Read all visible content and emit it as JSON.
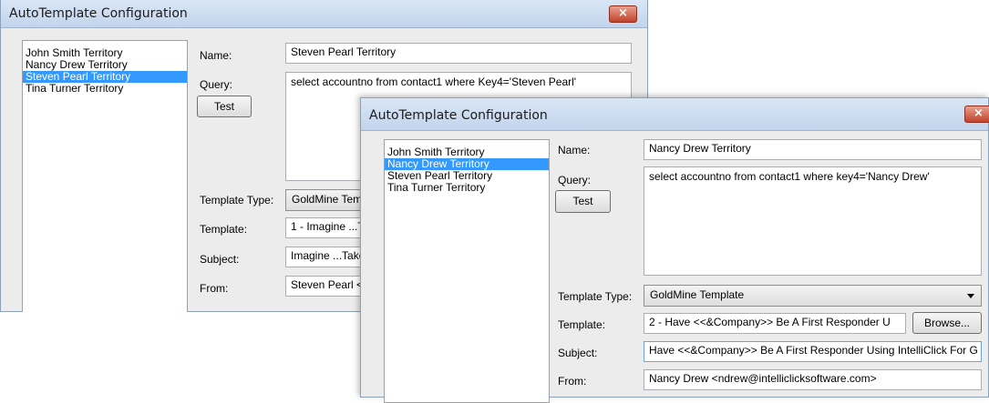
{
  "back_window": {
    "title": "AutoTemplate Configuration",
    "close_glyph": "×",
    "territories": [
      "John Smith Territory",
      "Nancy Drew Territory",
      "Steven Pearl Territory",
      "Tina Turner Territory"
    ],
    "selected_index": 2,
    "name_label": "Name:",
    "name_value": "Steven Pearl Territory",
    "query_label": "Query:",
    "query_value": "select accountno from contact1 where Key4='Steven Pearl'",
    "test_button": "Test",
    "template_type_label": "Template Type:",
    "template_type_value": "GoldMine Temp",
    "template_label": "Template:",
    "template_value": "1 - Imagine ...Ta",
    "subject_label": "Subject:",
    "subject_value": "Imagine ...Take",
    "from_label": "From:",
    "from_value": "Steven Pearl <s"
  },
  "front_window": {
    "title": "AutoTemplate Configuration",
    "close_glyph": "×",
    "territories": [
      "John Smith Territory",
      "Nancy Drew Territory",
      "Steven Pearl Territory",
      "Tina Turner Territory"
    ],
    "selected_index": 1,
    "name_label": "Name:",
    "name_value": "Nancy Drew Territory",
    "query_label": "Query:",
    "query_value": "select accountno from contact1 where key4='Nancy Drew'",
    "test_button": "Test",
    "template_type_label": "Template Type:",
    "template_type_value": "GoldMine Template",
    "template_label": "Template:",
    "template_value": "2 - Have <<&Company>> Be A First Responder U",
    "browse_button": "Browse...",
    "subject_label": "Subject:",
    "subject_value": "Have <<&Company>> Be A First Responder Using IntelliClick For G",
    "from_label": "From:",
    "from_value": "Nancy Drew <ndrew@intelliclicksoftware.com>"
  },
  "colors": {
    "selection": "#3399ff",
    "titlebar": "#c9d9ef",
    "close_button": "#c7462c"
  }
}
